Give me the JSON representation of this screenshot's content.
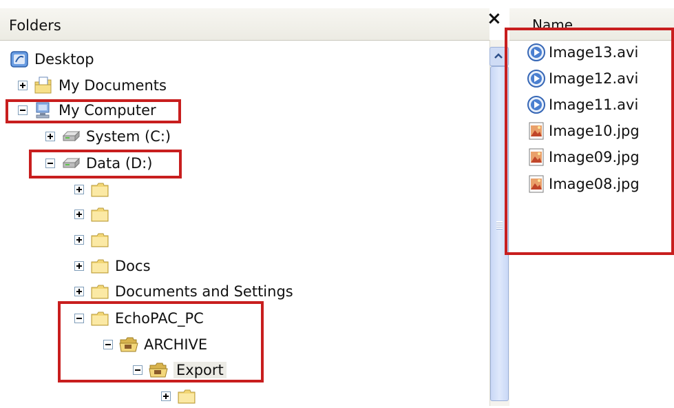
{
  "folders_pane": {
    "title": "Folders",
    "close_symbol": "×"
  },
  "list_pane": {
    "column_name": "Name"
  },
  "tree": [
    {
      "label": "Desktop",
      "icon": "desktop-icon",
      "expander": "none"
    },
    {
      "label": "My Documents",
      "icon": "my-documents-icon",
      "expander": "plus"
    },
    {
      "label": "My Computer",
      "icon": "my-computer-icon",
      "expander": "minus"
    },
    {
      "label": "System (C:)",
      "icon": "drive-icon",
      "expander": "plus"
    },
    {
      "label": "Data (D:)",
      "icon": "drive-icon",
      "expander": "minus"
    },
    {
      "label": "",
      "icon": "folder-icon",
      "expander": "plus"
    },
    {
      "label": "",
      "icon": "folder-icon",
      "expander": "plus"
    },
    {
      "label": "",
      "icon": "folder-icon",
      "expander": "plus"
    },
    {
      "label": "Docs",
      "icon": "folder-icon",
      "expander": "plus"
    },
    {
      "label": "Documents and Settings",
      "icon": "folder-icon",
      "expander": "plus"
    },
    {
      "label": "EchoPAC_PC",
      "icon": "folder-icon",
      "expander": "minus"
    },
    {
      "label": "ARCHIVE",
      "icon": "open-folder-icon",
      "expander": "minus"
    },
    {
      "label": "Export",
      "icon": "open-folder-icon",
      "expander": "minus"
    },
    {
      "label": "",
      "icon": "folder-icon",
      "expander": "plus"
    }
  ],
  "files": [
    {
      "name": "Image13.avi",
      "icon": "video-file-icon"
    },
    {
      "name": "Image12.avi",
      "icon": "video-file-icon"
    },
    {
      "name": "Image11.avi",
      "icon": "video-file-icon"
    },
    {
      "name": "Image10.jpg",
      "icon": "image-file-icon"
    },
    {
      "name": "Image09.jpg",
      "icon": "image-file-icon"
    },
    {
      "name": "Image08.jpg",
      "icon": "image-file-icon"
    }
  ],
  "colors": {
    "highlight": "#c81e1e",
    "scrollbar": "#c9d8f6"
  }
}
